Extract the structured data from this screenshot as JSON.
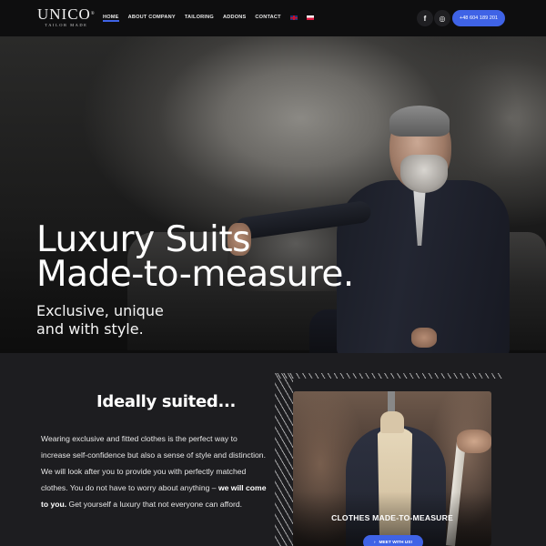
{
  "header": {
    "logo_main": "UNICO",
    "logo_mark": "®",
    "logo_sub": "TAILOR MADE",
    "nav": [
      {
        "label": "HOME",
        "active": true
      },
      {
        "label": "ABOUT COMPANY",
        "active": false
      },
      {
        "label": "TAILORING",
        "active": false
      },
      {
        "label": "ADDONS",
        "active": false
      },
      {
        "label": "CONTACT",
        "active": false
      }
    ],
    "languages": [
      {
        "code": "en",
        "icon": "uk-flag-icon"
      },
      {
        "code": "pl",
        "icon": "poland-flag-icon"
      }
    ],
    "social": {
      "facebook_glyph": "f",
      "instagram_glyph": "◎"
    },
    "phone": "+48 604 189 201"
  },
  "hero": {
    "title_line1": "Luxury Suits",
    "title_line2": "Made-to-measure.",
    "subtitle_line1": "Exclusive, unique",
    "subtitle_line2": "and with style."
  },
  "intro": {
    "title": "Ideally suited...",
    "text_before": "Wearing exclusive and fitted clothes is the perfect way to increase self-confidence but also a sense of style and distinction. We will look after you to provide you with perfectly matched clothes. You do not have to worry about anything – ",
    "text_bold": "we will come to you.",
    "text_after": " Get yourself a luxury that not everyone can afford."
  },
  "card": {
    "title": "CLOTHES MADE-TO-MEASURE",
    "button_label": "MEET WITH US!",
    "button_icon": "›"
  },
  "colors": {
    "accent": "#3f63e6",
    "header_bg": "#0e0e0f",
    "content_bg": "#1d1d20"
  }
}
